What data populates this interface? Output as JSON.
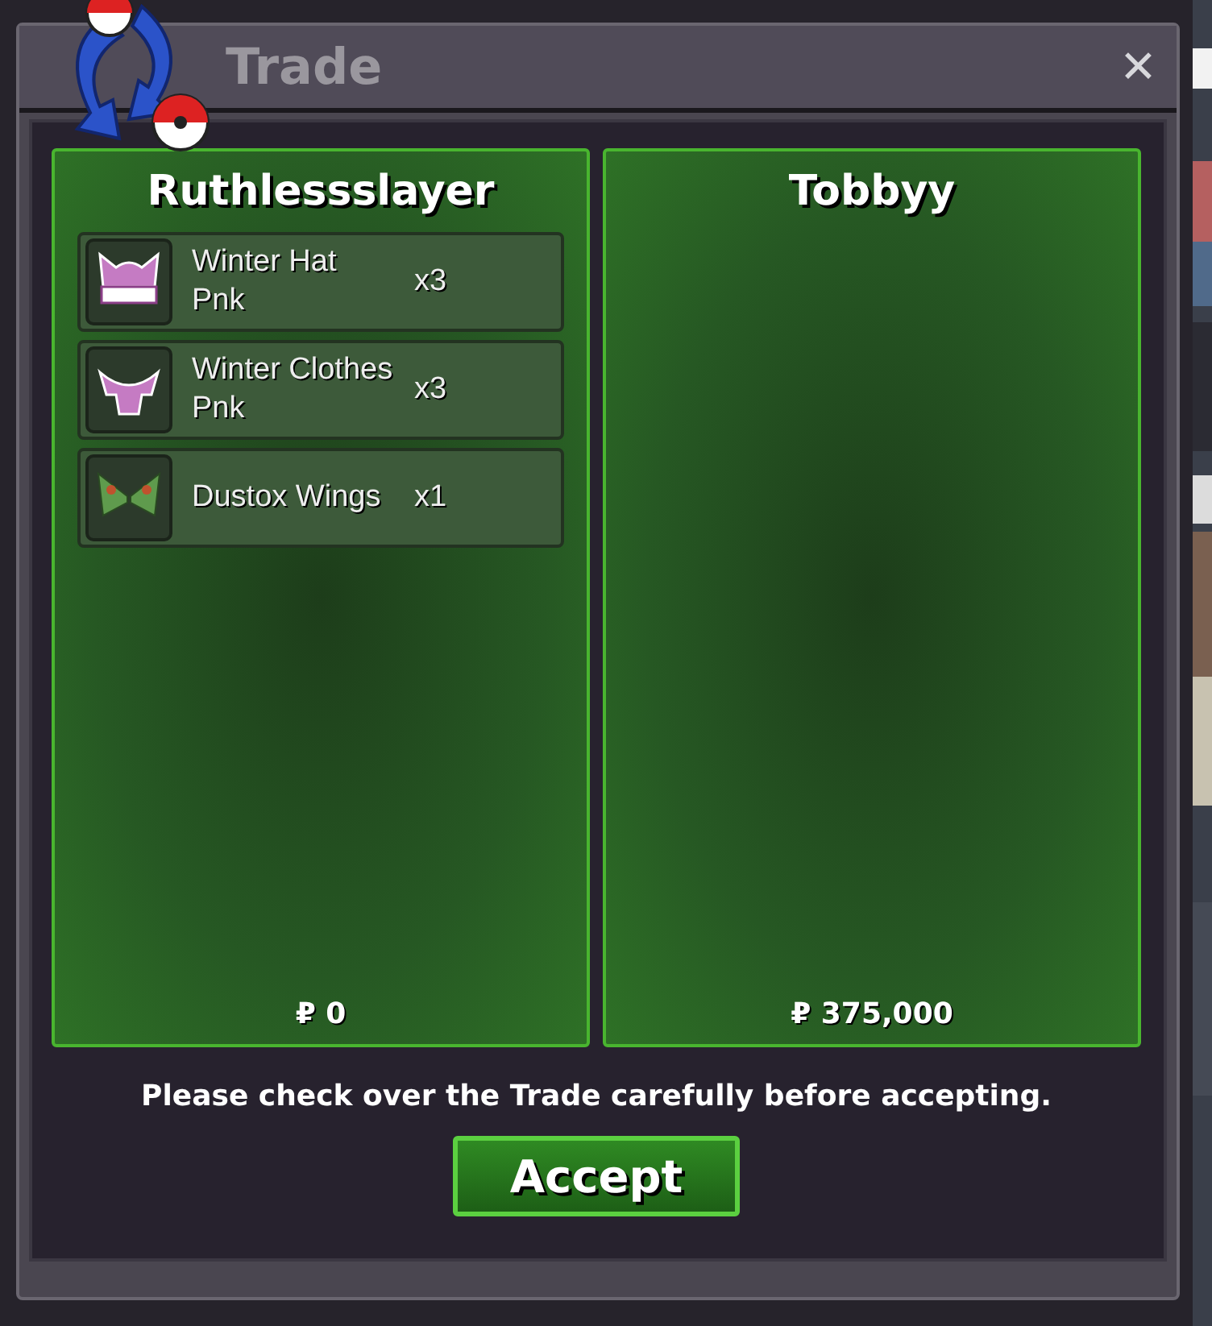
{
  "window": {
    "title": "Trade",
    "close": "✕"
  },
  "panels": [
    {
      "player": "Ruthlessslayer",
      "money": "₽ 0",
      "items": [
        {
          "kind": "hat",
          "name": "Winter Hat Pnk",
          "quantity": "x3"
        },
        {
          "kind": "clothes",
          "name": "Winter Clothes Pnk",
          "quantity": "x3"
        },
        {
          "kind": "wings",
          "name": "Dustox Wings",
          "quantity": "x1"
        }
      ]
    },
    {
      "player": "Tobbyy",
      "money": "₽ 375,000"
    }
  ],
  "notice": "Please check over the Trade carefully before accepting.",
  "accept_button": "Accept"
}
